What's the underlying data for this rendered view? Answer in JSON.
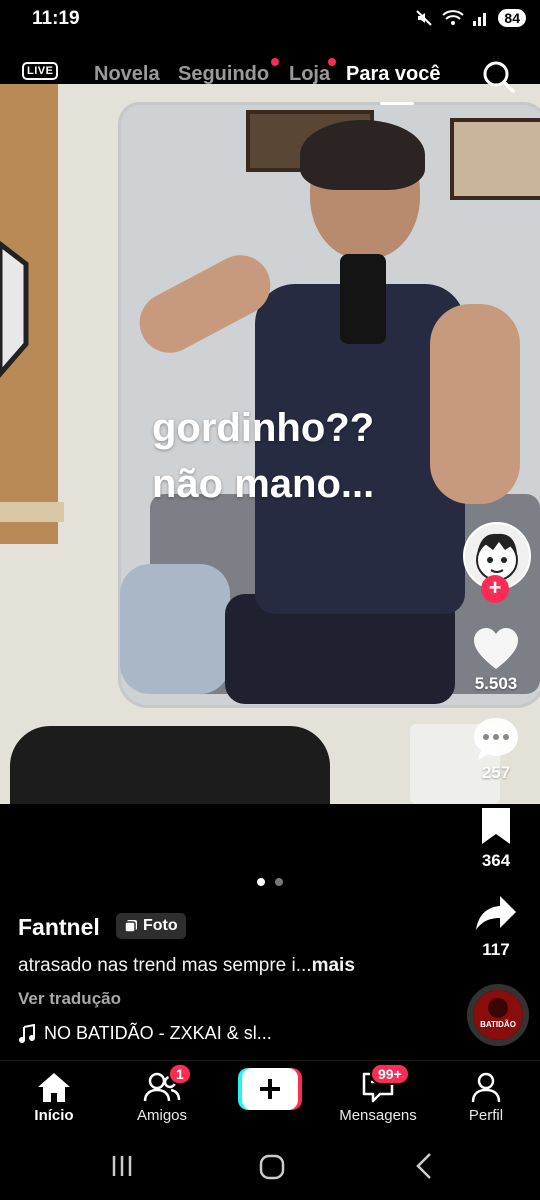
{
  "status_bar": {
    "time": "11:19",
    "battery": "84"
  },
  "top_nav": {
    "live_label": "LIVE",
    "tabs": [
      {
        "label": "Novela"
      },
      {
        "label": "Seguindo"
      },
      {
        "label": "Loja"
      },
      {
        "label": "Para você"
      }
    ]
  },
  "post": {
    "overlay_lines": [
      "gordinho??",
      "não mano..."
    ],
    "likes": "5.503",
    "comments": "257",
    "saves": "364",
    "shares": "117",
    "author": "Fantnel",
    "type_badge": "Foto",
    "caption": "atrasado nas trend mas sempre i...",
    "caption_more": "mais",
    "translate": "Ver tradução",
    "music": "NO BATIDÃO - ZXKAI & sl...",
    "music_disc_text": "BATIDÃO",
    "photo_index": 1,
    "photo_count": 2
  },
  "bottom_nav": {
    "items": [
      {
        "label": "Início"
      },
      {
        "label": "Amigos",
        "badge": "1"
      },
      {
        "label": "Mensagens",
        "badge": "99+"
      },
      {
        "label": "Perfil"
      }
    ]
  },
  "colors": {
    "accent": "#fe2c55",
    "teal": "#25f4ee",
    "background": "#000000"
  }
}
